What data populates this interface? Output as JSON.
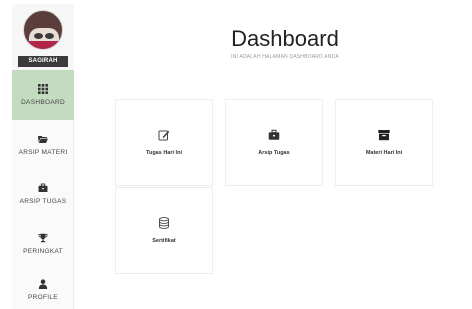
{
  "profile": {
    "username": "SAGIRAH"
  },
  "sidebar": {
    "items": [
      {
        "label": "DASHBOARD",
        "icon": "grid-icon",
        "active": true
      },
      {
        "label": "ARSIP MATERI",
        "icon": "folder-open-icon",
        "active": false
      },
      {
        "label": "ARSIP TUGAS",
        "icon": "briefcase-icon",
        "active": false
      },
      {
        "label": "PERINGKAT",
        "icon": "trophy-icon",
        "active": false
      },
      {
        "label": "PROFILE",
        "icon": "user-icon",
        "active": false
      }
    ]
  },
  "header": {
    "title": "Dashboard",
    "subtitle": "INI ADALAH HALAMAN DASHBOARD ANDA"
  },
  "cards": [
    {
      "label": "Tugas Hari Ini",
      "icon": "edit-icon"
    },
    {
      "label": "Arsip Tugas",
      "icon": "briefcase-icon"
    },
    {
      "label": "Materi Hari Ini",
      "icon": "archive-icon"
    },
    {
      "label": "Sertifikat",
      "icon": "database-icon"
    }
  ],
  "colors": {
    "active_nav": "#c3dcc0",
    "username_bg": "#3b3b3b"
  }
}
